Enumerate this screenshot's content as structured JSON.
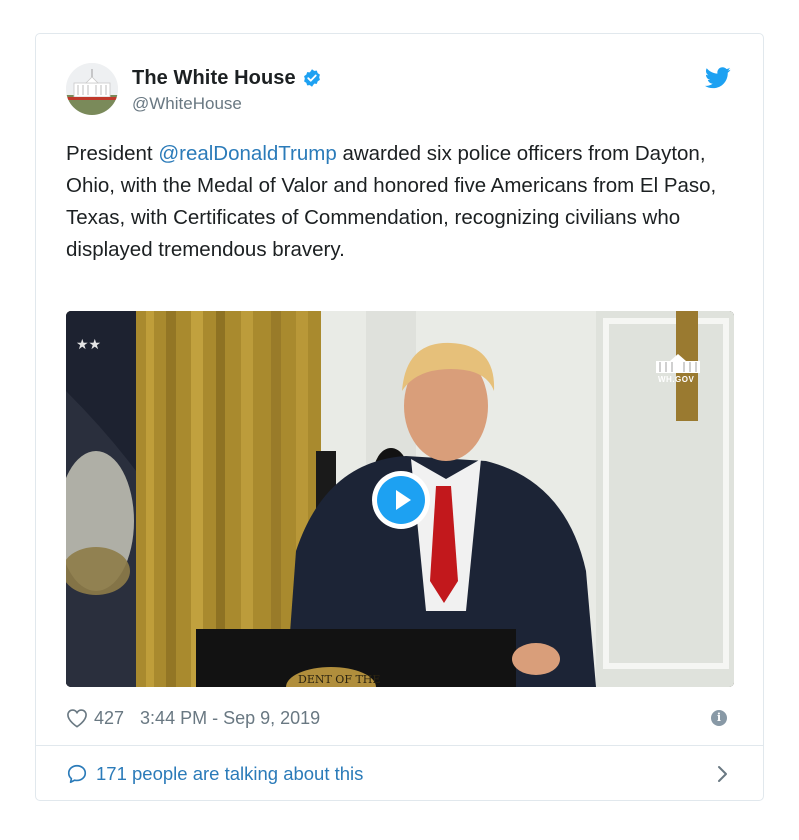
{
  "tweet": {
    "display_name": "The White House",
    "handle": "@WhiteHouse",
    "text_before": "President ",
    "mention": "@realDonaldTrump",
    "text_after": " awarded six police officers from Dayton, Ohio, with the Medal of Valor and honored five Americans from El Paso, Texas, with Certificates of Commendation, recognizing civilians who displayed tremendous bravery.",
    "likes": "427",
    "timestamp": "3:44 PM - Sep 9, 2019",
    "talking": "171 people are talking about this"
  },
  "media": {
    "watermark": "WH.GOV",
    "podium_seal_text": "DENT OF THE"
  },
  "colors": {
    "brand_blue": "#1da1f2",
    "link_blue": "#2b7bb9",
    "muted_gray": "#697882"
  }
}
